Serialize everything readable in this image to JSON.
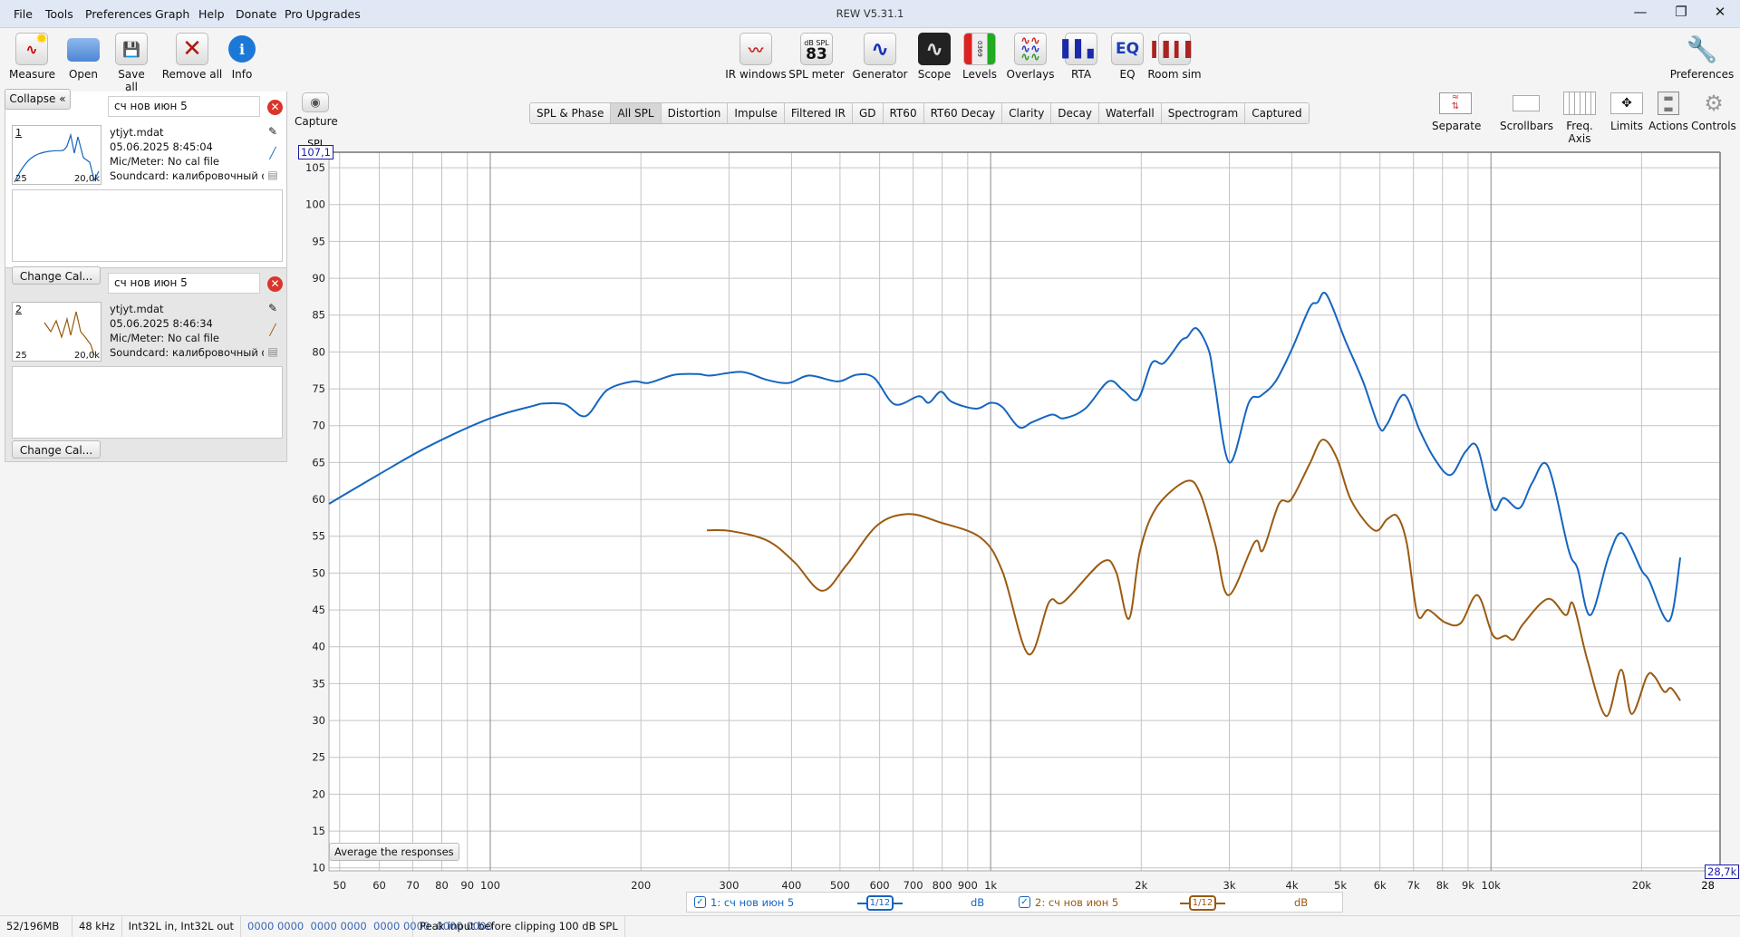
{
  "window": {
    "title": "REW V5.31.1",
    "minimize": "—",
    "restore": "❐",
    "close": "✕"
  },
  "menu": [
    "File",
    "Tools",
    "Preferences",
    "Graph",
    "Help",
    "Donate",
    "Pro Upgrades"
  ],
  "toolbar_left": [
    "Measure",
    "Open",
    "Save all",
    "Remove all",
    "Info"
  ],
  "toolbar_center": [
    "IR windows",
    "SPL meter",
    "Generator",
    "Scope",
    "Levels",
    "Overlays",
    "RTA",
    "EQ",
    "Room sim"
  ],
  "spl_meter_icon": {
    "unit": "dB SPL",
    "value": "83"
  },
  "levels_icon_digits": "0369",
  "eq_icon_text": "EQ",
  "preferences_label": "Preferences",
  "capture_label": "Capture",
  "graph_tabs": [
    "SPL & Phase",
    "All SPL",
    "Distortion",
    "Impulse",
    "Filtered IR",
    "GD",
    "RT60",
    "RT60 Decay",
    "Clarity",
    "Decay",
    "Waterfall",
    "Spectrogram",
    "Captured"
  ],
  "active_tab": "All SPL",
  "graph_controls": [
    "Separate",
    "Scrollbars",
    "Freq. Axis",
    "Limits",
    "Actions",
    "Controls"
  ],
  "left_panel": {
    "collapse_label": "Collapse",
    "measurements": [
      {
        "number": "1",
        "name": "сч нов июн 5",
        "file": "ytjyt.mdat",
        "date": "05.06.2025 8:45:04",
        "mic": "Mic/Meter: No cal file",
        "soundcard": "Soundcard: калибровочный файл",
        "thumb_min": "25",
        "thumb_max": "20,0k",
        "change_cal": "Change Cal...",
        "color": "#1565c0"
      },
      {
        "number": "2",
        "name": "сч нов июн 5",
        "file": "ytjyt.mdat",
        "date": "05.06.2025 8:46:34",
        "mic": "Mic/Meter: No cal file",
        "soundcard": "Soundcard: калибровочный файл",
        "thumb_min": "25",
        "thumb_max": "20,0k",
        "change_cal": "Change Cal...",
        "color": "#9a5a10"
      }
    ]
  },
  "average_button": "Average the responses",
  "legend": [
    {
      "label": "1: сч нов июн 5",
      "smoothing": "1/12",
      "unit": "dB",
      "color": "#1565c0",
      "checked": true
    },
    {
      "label": "2: сч нов июн 5",
      "smoothing": "1/12",
      "unit": "dB",
      "color": "#9a5a10",
      "checked": true
    }
  ],
  "status_bar": [
    "52/196MB",
    "48 kHz",
    "Int32L in, Int32L out",
    "0000 0000  0000 0000  0000 0000  0000 0000",
    "Peak input before clipping 100 dB SPL"
  ],
  "chart_data": {
    "type": "line",
    "title": "All SPL",
    "ylabel": "SPL",
    "xlabel": "",
    "x_scale": "log",
    "xlim": [
      47.6,
      28700
    ],
    "ylim": [
      9.6,
      107.1
    ],
    "y_top_readout": "107,1",
    "x_right_readout": "28,7k",
    "x_right_partial_label": "28",
    "grid": true,
    "y_ticks": [
      10,
      15,
      20,
      25,
      30,
      35,
      40,
      45,
      50,
      55,
      60,
      65,
      70,
      75,
      80,
      85,
      90,
      95,
      100,
      105
    ],
    "x_ticks": [
      {
        "v": 50,
        "l": "50"
      },
      {
        "v": 60,
        "l": "60"
      },
      {
        "v": 70,
        "l": "70"
      },
      {
        "v": 80,
        "l": "80"
      },
      {
        "v": 90,
        "l": "90"
      },
      {
        "v": 100,
        "l": "100"
      },
      {
        "v": 200,
        "l": "200"
      },
      {
        "v": 300,
        "l": "300"
      },
      {
        "v": 400,
        "l": "400"
      },
      {
        "v": 500,
        "l": "500"
      },
      {
        "v": 600,
        "l": "600"
      },
      {
        "v": 700,
        "l": "700"
      },
      {
        "v": 800,
        "l": "800"
      },
      {
        "v": 900,
        "l": "900"
      },
      {
        "v": 1000,
        "l": "1k"
      },
      {
        "v": 2000,
        "l": "2k"
      },
      {
        "v": 3000,
        "l": "3k"
      },
      {
        "v": 4000,
        "l": "4k"
      },
      {
        "v": 5000,
        "l": "5k"
      },
      {
        "v": 6000,
        "l": "6k"
      },
      {
        "v": 7000,
        "l": "7k"
      },
      {
        "v": 8000,
        "l": "8k"
      },
      {
        "v": 9000,
        "l": "9k"
      },
      {
        "v": 10000,
        "l": "10k"
      },
      {
        "v": 20000,
        "l": "20k"
      }
    ],
    "series": [
      {
        "name": "1: сч нов июн 5",
        "color": "#1565c0",
        "points": [
          [
            47.6,
            59.4
          ],
          [
            59.6,
            63.3
          ],
          [
            75.8,
            67.3
          ],
          [
            100,
            71
          ],
          [
            122,
            72.7
          ],
          [
            128,
            73
          ],
          [
            141,
            72.9
          ],
          [
            155,
            71.3
          ],
          [
            171,
            74.8
          ],
          [
            193,
            76
          ],
          [
            207,
            75.8
          ],
          [
            233,
            76.9
          ],
          [
            260,
            77
          ],
          [
            276,
            76.8
          ],
          [
            318,
            77.3
          ],
          [
            358,
            76.2
          ],
          [
            395,
            75.8
          ],
          [
            434,
            76.8
          ],
          [
            495,
            76
          ],
          [
            539,
            76.9
          ],
          [
            585,
            76.5
          ],
          [
            643,
            72.9
          ],
          [
            718,
            74
          ],
          [
            752,
            73.1
          ],
          [
            795,
            74.6
          ],
          [
            838,
            73.2
          ],
          [
            935,
            72.3
          ],
          [
            1000,
            73.1
          ],
          [
            1056,
            72.5
          ],
          [
            1140,
            69.8
          ],
          [
            1213,
            70.5
          ],
          [
            1327,
            71.5
          ],
          [
            1400,
            71
          ],
          [
            1545,
            72.3
          ],
          [
            1720,
            76
          ],
          [
            1840,
            74.8
          ],
          [
            1970,
            73.6
          ],
          [
            2100,
            78.5
          ],
          [
            2220,
            78.5
          ],
          [
            2400,
            81.5
          ],
          [
            2470,
            82
          ],
          [
            2580,
            83.2
          ],
          [
            2730,
            80.2
          ],
          [
            2800,
            76
          ],
          [
            3000,
            65
          ],
          [
            3280,
            73.1
          ],
          [
            3460,
            74
          ],
          [
            3710,
            76
          ],
          [
            3990,
            80.2
          ],
          [
            4340,
            86
          ],
          [
            4500,
            86.7
          ],
          [
            4690,
            87.8
          ],
          [
            5120,
            81.5
          ],
          [
            5550,
            76
          ],
          [
            5980,
            69.8
          ],
          [
            6200,
            70.2
          ],
          [
            6700,
            74.2
          ],
          [
            7200,
            69.4
          ],
          [
            7700,
            65.6
          ],
          [
            8300,
            63.3
          ],
          [
            8900,
            66.5
          ],
          [
            9400,
            67
          ],
          [
            10100,
            58.8
          ],
          [
            10600,
            60.2
          ],
          [
            11400,
            58.8
          ],
          [
            12100,
            62.3
          ],
          [
            13000,
            64.5
          ],
          [
            14300,
            53.1
          ],
          [
            14900,
            50.6
          ],
          [
            15800,
            44.3
          ],
          [
            17200,
            52.3
          ],
          [
            18300,
            55.4
          ],
          [
            20000,
            50.4
          ],
          [
            20700,
            49
          ],
          [
            22700,
            43.5
          ],
          [
            23900,
            52.1
          ]
        ]
      },
      {
        "name": "2: сч нов июн 5",
        "color": "#9a5a10",
        "points": [
          [
            271,
            55.8
          ],
          [
            303,
            55.7
          ],
          [
            358,
            54.4
          ],
          [
            405,
            51.5
          ],
          [
            460,
            47.6
          ],
          [
            514,
            51
          ],
          [
            594,
            56.5
          ],
          [
            684,
            58
          ],
          [
            791,
            56.9
          ],
          [
            955,
            54.8
          ],
          [
            1056,
            50.2
          ],
          [
            1190,
            39
          ],
          [
            1310,
            46.1
          ],
          [
            1400,
            46.1
          ],
          [
            1670,
            51.5
          ],
          [
            1780,
            50.2
          ],
          [
            1890,
            43.8
          ],
          [
            1990,
            53.1
          ],
          [
            2150,
            59
          ],
          [
            2470,
            62.5
          ],
          [
            2630,
            60.6
          ],
          [
            2810,
            54
          ],
          [
            2990,
            47
          ],
          [
            3370,
            54.2
          ],
          [
            3500,
            53.1
          ],
          [
            3770,
            59.4
          ],
          [
            3990,
            60
          ],
          [
            4340,
            64.8
          ],
          [
            4610,
            68.1
          ],
          [
            4920,
            65.6
          ],
          [
            5260,
            59.8
          ],
          [
            5850,
            55.8
          ],
          [
            6200,
            57.3
          ],
          [
            6500,
            57.7
          ],
          [
            6790,
            54
          ],
          [
            7130,
            44.4
          ],
          [
            7500,
            45
          ],
          [
            8100,
            43.3
          ],
          [
            8700,
            43.2
          ],
          [
            9400,
            47
          ],
          [
            10100,
            41.5
          ],
          [
            10700,
            41.5
          ],
          [
            11100,
            41
          ],
          [
            11600,
            43.1
          ],
          [
            13000,
            46.5
          ],
          [
            14100,
            44.3
          ],
          [
            14600,
            45.8
          ],
          [
            15600,
            38.1
          ],
          [
            17000,
            30.6
          ],
          [
            18200,
            36.9
          ],
          [
            19100,
            30.9
          ],
          [
            20500,
            36
          ],
          [
            21200,
            36
          ],
          [
            22200,
            33.9
          ],
          [
            22900,
            34.4
          ],
          [
            23900,
            32.7
          ]
        ]
      }
    ]
  }
}
